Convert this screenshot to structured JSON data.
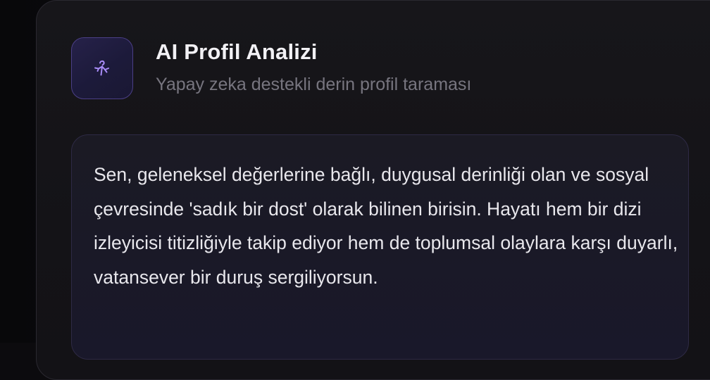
{
  "header": {
    "title": "AI Profil Analizi",
    "subtitle": "Yapay zeka destekli derin profil taraması",
    "icon": "spark-figure-icon"
  },
  "analysis": {
    "text": "Sen, geleneksel değerlerine bağlı, duygusal derinliği olan ve sosyal çevresinde 'sadık bir dost' olarak bilinen birisin. Hayatı hem bir dizi izleyicisi titizliğiyle takip ediyor hem de toplumsal olaylara karşı duyarlı, vatansever bir duruş sergiliyorsun."
  },
  "colors": {
    "accent": "#a78bfa",
    "icon_border": "#4b3f86",
    "card_background": "#151418",
    "box_border": "#2e2a45"
  }
}
